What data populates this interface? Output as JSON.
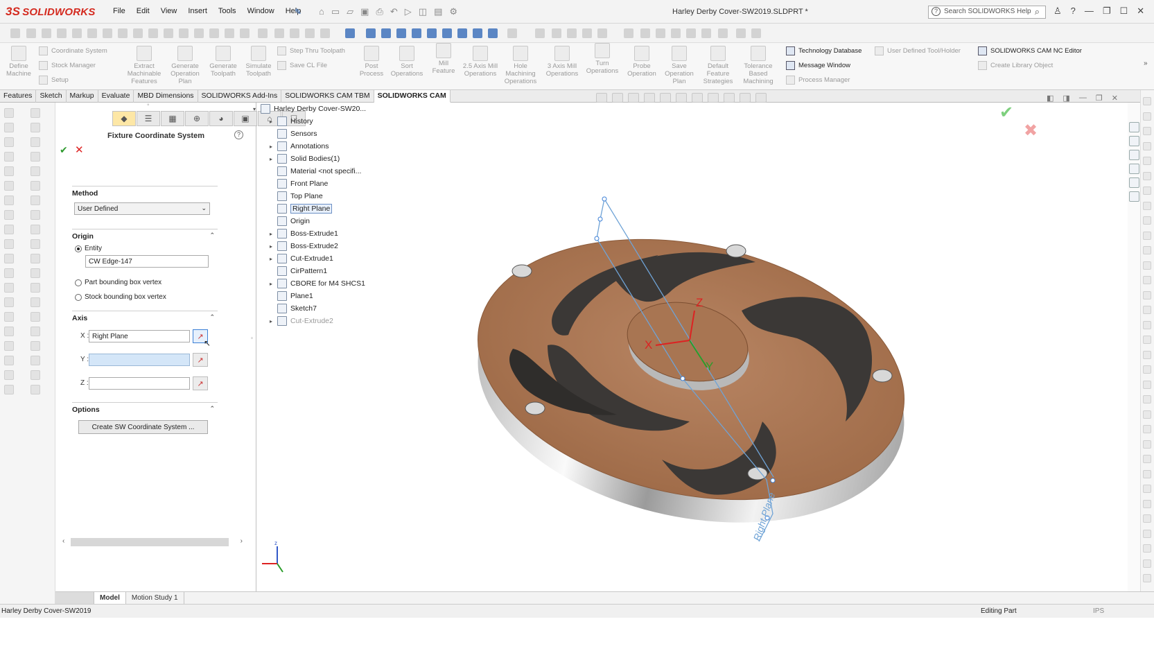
{
  "app": {
    "brand": "SOLIDWORKS",
    "doc_title": "Harley Derby Cover-SW2019.SLDPRT *",
    "search_placeholder": "Search SOLIDWORKS Help",
    "brand_color": "#d42a1f"
  },
  "menu": [
    "File",
    "Edit",
    "View",
    "Insert",
    "Tools",
    "Window",
    "Help"
  ],
  "ribbon": {
    "define_machine": "Define Machine",
    "coordinate_system": "Coordinate System",
    "stock_manager": "Stock Manager",
    "setup": "Setup",
    "extract_features": "Extract Machinable Features",
    "generate_plan": "Generate Operation Plan",
    "generate_toolpath": "Generate Toolpath",
    "simulate_toolpath": "Simulate Toolpath",
    "step_thru": "Step Thru Toolpath",
    "save_cl": "Save CL File",
    "post_process": "Post Process",
    "sort_operations": "Sort Operations",
    "mill_feature": "Mill Feature",
    "axis_25": "2.5 Axis Mill Operations",
    "hole_machining": "Hole Machining Operations",
    "axis_3": "3 Axis Mill Operations",
    "turn_operations": "Turn Operations",
    "probe_operation": "Probe Operation",
    "save_plan": "Save Operation Plan",
    "default_strategies": "Default Feature Strategies",
    "tolerance_machining": "Tolerance Based Machining",
    "technology_database": "Technology Database",
    "message_window": "Message Window",
    "process_manager": "Process Manager",
    "user_tool_holder": "User Defined Tool/Holder",
    "nc_editor": "SOLIDWORKS CAM NC Editor",
    "library_object": "Create Library Object"
  },
  "tabs": [
    "Features",
    "Sketch",
    "Markup",
    "Evaluate",
    "MBD Dimensions",
    "SOLIDWORKS Add-Ins",
    "SOLIDWORKS CAM TBM",
    "SOLIDWORKS CAM"
  ],
  "active_tab": "SOLIDWORKS CAM",
  "pm": {
    "title": "Fixture Coordinate System",
    "method_label": "Method",
    "method_value": "User Defined",
    "origin_label": "Origin",
    "entity_label": "Entity",
    "entity_value": "CW Edge-147",
    "part_bbox_label": "Part bounding box vertex",
    "stock_bbox_label": "Stock bounding box vertex",
    "axis_label": "Axis",
    "x_label": "X :",
    "x_value": "Right Plane",
    "y_label": "Y :",
    "y_value": "",
    "z_label": "Z :",
    "z_value": "",
    "options_label": "Options",
    "create_btn": "Create SW Coordinate System ..."
  },
  "tree": [
    {
      "label": "Harley Derby Cover-SW20...",
      "level": 0,
      "expand": "open"
    },
    {
      "label": "History",
      "level": 1,
      "expand": "closed"
    },
    {
      "label": "Sensors",
      "level": 1,
      "expand": ""
    },
    {
      "label": "Annotations",
      "level": 1,
      "expand": "closed"
    },
    {
      "label": "Solid Bodies(1)",
      "level": 1,
      "expand": "closed"
    },
    {
      "label": "Material <not specifi...",
      "level": 1,
      "expand": ""
    },
    {
      "label": "Front Plane",
      "level": 1,
      "expand": ""
    },
    {
      "label": "Top Plane",
      "level": 1,
      "expand": ""
    },
    {
      "label": "Right Plane",
      "level": 1,
      "expand": "",
      "selected": true
    },
    {
      "label": "Origin",
      "level": 1,
      "expand": ""
    },
    {
      "label": "Boss-Extrude1",
      "level": 1,
      "expand": "closed"
    },
    {
      "label": "Boss-Extrude2",
      "level": 1,
      "expand": "closed"
    },
    {
      "label": "Cut-Extrude1",
      "level": 1,
      "expand": "closed"
    },
    {
      "label": "CirPattern1",
      "level": 1,
      "expand": ""
    },
    {
      "label": "CBORE for M4 SHCS1",
      "level": 1,
      "expand": "closed"
    },
    {
      "label": "Plane1",
      "level": 1,
      "expand": ""
    },
    {
      "label": "Sketch7",
      "level": 1,
      "expand": ""
    },
    {
      "label": "Cut-Extrude2",
      "level": 1,
      "expand": "closed",
      "dim": true
    }
  ],
  "viewport": {
    "axis_x": "X",
    "axis_y": "Y",
    "axis_z": "Z",
    "plane_label": "Right Plane",
    "triad_z": "z"
  },
  "bottom_tabs": [
    "Model",
    "Motion Study 1"
  ],
  "status": {
    "left": "Harley Derby Cover-SW2019",
    "mid": "Editing Part",
    "units": "IPS"
  }
}
